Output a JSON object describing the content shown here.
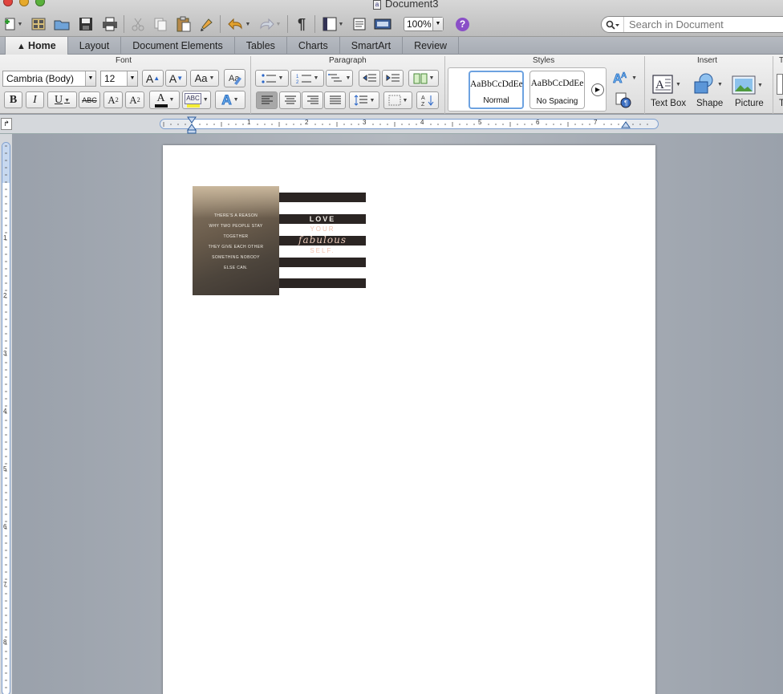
{
  "window": {
    "title": "Document3"
  },
  "toolbar": {
    "zoom": "100%",
    "help": "?",
    "search_placeholder": "Search in Document"
  },
  "tabs": [
    {
      "label": "Home"
    },
    {
      "label": "Layout"
    },
    {
      "label": "Document Elements"
    },
    {
      "label": "Tables"
    },
    {
      "label": "Charts"
    },
    {
      "label": "SmartArt"
    },
    {
      "label": "Review"
    }
  ],
  "ribbon": {
    "groups": {
      "font": "Font",
      "paragraph": "Paragraph",
      "styles": "Styles",
      "insert": "Insert",
      "cutoff": "T"
    },
    "font": {
      "family": "Cambria (Body)",
      "size": "12",
      "grow": "A",
      "shrink": "A",
      "case": "Aa",
      "bold": "B",
      "italic": "I",
      "underline": "U",
      "strike": "ABC",
      "superscript": "A",
      "subscript": "A",
      "color": "A",
      "highlight": "ABC",
      "effects": "A"
    },
    "styles": [
      {
        "sample": "AaBbCcDdEe",
        "name": "Normal"
      },
      {
        "sample": "AaBbCcDdEe",
        "name": "No Spacing"
      }
    ],
    "insert": {
      "textbox": "Text Box",
      "shape": "Shape",
      "picture": "Picture",
      "cutoff": "T"
    }
  },
  "ruler": {
    "h_numbers": [
      "1",
      "2",
      "3",
      "4",
      "5",
      "6",
      "7"
    ],
    "v_numbers": [
      "1",
      "2",
      "3",
      "4",
      "5",
      "6",
      "7",
      "8"
    ]
  },
  "document": {
    "image1_lines": [
      "THERE'S A REASON",
      "WHY TWO PEOPLE STAY",
      "TOGETHER",
      "THEY GIVE EACH OTHER",
      "SOMETHING NOBODY",
      "ELSE CAN."
    ],
    "image2": {
      "line1": "LOVE",
      "line2": "YOUR",
      "line3": "fabulous",
      "line4": "SELF."
    }
  },
  "colors": {
    "accent": "#1e5bb8",
    "help": "#8a4fc7",
    "tab_active": "#ececec",
    "stripe": "#2b2523",
    "peach": "#f2c1ad"
  }
}
